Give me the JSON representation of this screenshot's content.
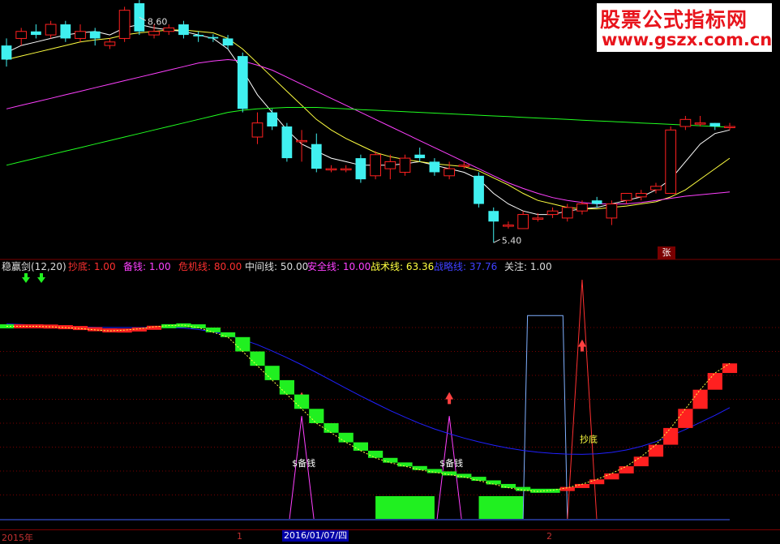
{
  "watermark": {
    "line1": "股票公式指标网",
    "line2": "www.gszx.com.cn"
  },
  "price_labels": {
    "high": "8.60",
    "low": "5.40"
  },
  "zhang_badge": "张",
  "indicator": {
    "name": "稳赢剑(12,20)",
    "params": [
      {
        "label": "抄底: 1.00",
        "color": "#ff3030"
      },
      {
        "label": "备钱: 1.00",
        "color": "#ff40ff"
      },
      {
        "label": "危机线: 80.00",
        "color": "#ff3030"
      },
      {
        "label": "中间线: 50.00",
        "color": "#dddddd"
      },
      {
        "label": "安全线: 10.00",
        "color": "#ff40ff"
      },
      {
        "label": "战术线: 63.36",
        "color": "#ffff40"
      },
      {
        "label": "战略线: 37.76",
        "color": "#4040ff"
      },
      {
        "label": "关注: 1.00",
        "color": "#dddddd"
      }
    ],
    "annotations": {
      "beiqian1": "$备钱",
      "beiqian2": "$备钱",
      "chaodi": "抄底"
    }
  },
  "date_axis": {
    "year": "2015年",
    "mark1": "1",
    "selected": "2016/01/07/四",
    "mark2": "2"
  },
  "colors": {
    "up": "#ff2020",
    "down": "#40f0f0",
    "ma5": "#ffffff",
    "ma10": "#ffff40",
    "ma30": "#ff40ff",
    "ma60": "#20ff20",
    "grid": "#7a0000"
  },
  "chart_data": [
    {
      "type": "candlestick",
      "price_range": [
        5.3,
        8.8
      ],
      "high_label": 8.6,
      "low_label": 5.4,
      "candles": [
        [
          8.2,
          8.0,
          8.3,
          7.9
        ],
        [
          8.3,
          8.4,
          8.45,
          8.2
        ],
        [
          8.4,
          8.35,
          8.5,
          8.3
        ],
        [
          8.35,
          8.5,
          8.55,
          8.3
        ],
        [
          8.5,
          8.3,
          8.55,
          8.25
        ],
        [
          8.3,
          8.4,
          8.5,
          8.25
        ],
        [
          8.4,
          8.3,
          8.45,
          8.2
        ],
        [
          8.2,
          8.25,
          8.3,
          8.15
        ],
        [
          8.3,
          8.7,
          8.75,
          8.25
        ],
        [
          8.8,
          8.4,
          8.85,
          8.35
        ],
        [
          8.35,
          8.4,
          8.5,
          8.3
        ],
        [
          8.4,
          8.45,
          8.5,
          8.35
        ],
        [
          8.5,
          8.35,
          8.55,
          8.3
        ],
        [
          8.35,
          8.33,
          8.4,
          8.25
        ],
        [
          8.32,
          8.3,
          8.36,
          8.25
        ],
        [
          8.3,
          8.2,
          8.35,
          8.15
        ],
        [
          8.05,
          7.3,
          8.1,
          7.25
        ],
        [
          6.9,
          7.1,
          7.25,
          6.8
        ],
        [
          7.25,
          7.05,
          7.3,
          7.0
        ],
        [
          7.05,
          6.6,
          7.1,
          6.55
        ],
        [
          6.85,
          6.85,
          7.0,
          6.55
        ],
        [
          6.8,
          6.45,
          6.95,
          6.4
        ],
        [
          6.45,
          6.45,
          6.5,
          6.4
        ],
        [
          6.45,
          6.45,
          6.5,
          6.4
        ],
        [
          6.6,
          6.3,
          6.65,
          6.25
        ],
        [
          6.35,
          6.65,
          6.7,
          6.3
        ],
        [
          6.45,
          6.55,
          6.65,
          6.3
        ],
        [
          6.4,
          6.6,
          6.65,
          6.35
        ],
        [
          6.65,
          6.6,
          6.75,
          6.55
        ],
        [
          6.55,
          6.4,
          6.6,
          6.35
        ],
        [
          6.35,
          6.45,
          6.55,
          6.3
        ],
        [
          6.5,
          6.5,
          6.55,
          6.45
        ],
        [
          6.35,
          5.95,
          6.4,
          5.9
        ],
        [
          5.85,
          5.7,
          5.9,
          5.4
        ],
        [
          5.65,
          5.65,
          5.7,
          5.6
        ],
        [
          5.6,
          5.8,
          5.85,
          5.6
        ],
        [
          5.75,
          5.75,
          5.82,
          5.7
        ],
        [
          5.8,
          5.85,
          5.9,
          5.75
        ],
        [
          5.75,
          5.9,
          5.95,
          5.7
        ],
        [
          5.85,
          5.95,
          6.0,
          5.8
        ],
        [
          6.0,
          5.95,
          6.05,
          5.9
        ],
        [
          5.75,
          5.95,
          6.0,
          5.65
        ],
        [
          6.0,
          6.1,
          6.1,
          5.95
        ],
        [
          6.05,
          6.1,
          6.15,
          6.0
        ],
        [
          6.15,
          6.2,
          6.25,
          6.1
        ],
        [
          6.1,
          7.0,
          7.05,
          6.1
        ],
        [
          7.05,
          7.15,
          7.2,
          7.0
        ],
        [
          7.1,
          7.1,
          7.2,
          7.05
        ],
        [
          7.1,
          7.05,
          7.1,
          7.0
        ],
        [
          7.05,
          7.05,
          7.1,
          7.0
        ]
      ],
      "ma_lines": [
        {
          "name": "MA5",
          "values": [
            8.1,
            8.2,
            8.25,
            8.3,
            8.35,
            8.38,
            8.4,
            8.35,
            8.45,
            8.5,
            8.45,
            8.42,
            8.4,
            8.35,
            8.3,
            8.15,
            7.85,
            7.5,
            7.25,
            7.0,
            6.8,
            6.7,
            6.6,
            6.55,
            6.5,
            6.5,
            6.5,
            6.52,
            6.55,
            6.5,
            6.45,
            6.4,
            6.3,
            6.1,
            5.95,
            5.85,
            5.8,
            5.8,
            5.85,
            5.88,
            5.9,
            5.95,
            6.0,
            6.05,
            6.15,
            6.3,
            6.55,
            6.8,
            6.95,
            7.0
          ]
        },
        {
          "name": "MA10",
          "values": [
            8.0,
            8.05,
            8.1,
            8.15,
            8.2,
            8.25,
            8.28,
            8.3,
            8.35,
            8.38,
            8.4,
            8.42,
            8.42,
            8.4,
            8.38,
            8.3,
            8.15,
            7.95,
            7.75,
            7.55,
            7.35,
            7.15,
            7.0,
            6.88,
            6.78,
            6.68,
            6.62,
            6.58,
            6.55,
            6.52,
            6.5,
            6.48,
            6.42,
            6.32,
            6.22,
            6.1,
            6.0,
            5.95,
            5.9,
            5.88,
            5.88,
            5.9,
            5.92,
            5.95,
            5.98,
            6.05,
            6.15,
            6.3,
            6.45,
            6.6
          ]
        },
        {
          "name": "MA30",
          "values": [
            7.3,
            7.35,
            7.4,
            7.45,
            7.5,
            7.55,
            7.6,
            7.65,
            7.7,
            7.75,
            7.8,
            7.85,
            7.9,
            7.95,
            7.98,
            8.0,
            7.98,
            7.92,
            7.85,
            7.75,
            7.65,
            7.55,
            7.45,
            7.35,
            7.25,
            7.15,
            7.05,
            6.95,
            6.85,
            6.75,
            6.65,
            6.55,
            6.45,
            6.35,
            6.25,
            6.17,
            6.1,
            6.04,
            6.0,
            5.97,
            5.95,
            5.95,
            5.95,
            5.97,
            6.0,
            6.03,
            6.06,
            6.08,
            6.1,
            6.12
          ]
        },
        {
          "name": "MA60",
          "values": [
            6.5,
            6.55,
            6.6,
            6.65,
            6.7,
            6.75,
            6.8,
            6.85,
            6.9,
            6.95,
            7.0,
            7.05,
            7.1,
            7.15,
            7.2,
            7.25,
            7.28,
            7.3,
            7.31,
            7.32,
            7.32,
            7.32,
            7.31,
            7.3,
            7.29,
            7.28,
            7.27,
            7.26,
            7.25,
            7.24,
            7.23,
            7.22,
            7.21,
            7.2,
            7.19,
            7.18,
            7.17,
            7.16,
            7.15,
            7.14,
            7.13,
            7.12,
            7.11,
            7.1,
            7.09,
            7.08,
            7.07,
            7.06,
            7.05,
            7.04
          ]
        }
      ]
    },
    {
      "type": "line",
      "name": "稳赢剑(12,20)",
      "x": "bar index (50 bars)",
      "ylim": [
        0,
        100
      ],
      "series": [
        {
          "name": "战术线",
          "values": [
            80.5,
            80.5,
            80.5,
            80.3,
            80.0,
            79.6,
            79.0,
            78.6,
            78.9,
            79.5,
            80.3,
            80.8,
            81.0,
            80.0,
            78.0,
            76.0,
            70.0,
            64.0,
            58.0,
            52.0,
            46.0,
            40.0,
            36.0,
            32.0,
            28.5,
            25.5,
            23.5,
            22.0,
            20.5,
            19.5,
            18.5,
            17.5,
            16.0,
            14.5,
            13.0,
            12.0,
            11.5,
            12.0,
            13.0,
            14.5,
            16.5,
            19.0,
            22.0,
            26.0,
            31.0,
            38.0,
            46.0,
            54.0,
            61.0,
            65.0
          ]
        },
        {
          "name": "战略线",
          "values": [
            81.5,
            81.3,
            81.0,
            80.7,
            80.4,
            80.2,
            80.1,
            80.0,
            80.0,
            80.0,
            80.0,
            80.0,
            79.8,
            79.2,
            78.2,
            76.8,
            75.0,
            72.8,
            70.2,
            67.4,
            64.4,
            61.2,
            57.9,
            54.6,
            51.4,
            48.3,
            45.3,
            42.5,
            39.9,
            37.6,
            35.6,
            33.8,
            32.2,
            30.8,
            29.6,
            28.6,
            27.9,
            27.4,
            27.1,
            27.0,
            27.2,
            27.8,
            28.8,
            30.3,
            32.3,
            34.7,
            37.4,
            40.3,
            43.3,
            46.5
          ]
        },
        {
          "name": "备钱",
          "values": [
            0,
            0,
            0,
            0,
            0,
            0,
            0,
            0,
            0,
            0,
            0,
            0,
            0,
            0,
            0,
            0,
            0,
            0,
            0,
            0,
            0,
            0,
            0,
            0,
            0,
            0,
            0,
            0,
            0,
            0,
            0,
            0,
            0,
            0,
            0,
            0,
            0,
            0,
            0,
            0,
            0,
            0,
            0,
            0,
            0,
            0,
            0,
            0,
            0,
            0
          ]
        },
        {
          "name": "抄底",
          "values": [
            0,
            0,
            0,
            0,
            0,
            0,
            0,
            0,
            0,
            0,
            0,
            0,
            0,
            0,
            0,
            0,
            0,
            0,
            0,
            0,
            0,
            0,
            0,
            0,
            0,
            0,
            0,
            0,
            0,
            0,
            0,
            0,
            0,
            0,
            0,
            0,
            0,
            0,
            0,
            0,
            0,
            0,
            0,
            0,
            0,
            0,
            0,
            0,
            0,
            0
          ]
        }
      ],
      "signals": {
        "beiqian_bars": [
          20,
          30
        ],
        "chaodi_bar": 39,
        "zone_bars": [
          [
            25,
            29
          ],
          [
            32,
            35
          ]
        ],
        "high_zone_bars": [
          [
            35,
            38
          ]
        ]
      },
      "hlines": [
        80,
        50,
        10
      ]
    }
  ]
}
